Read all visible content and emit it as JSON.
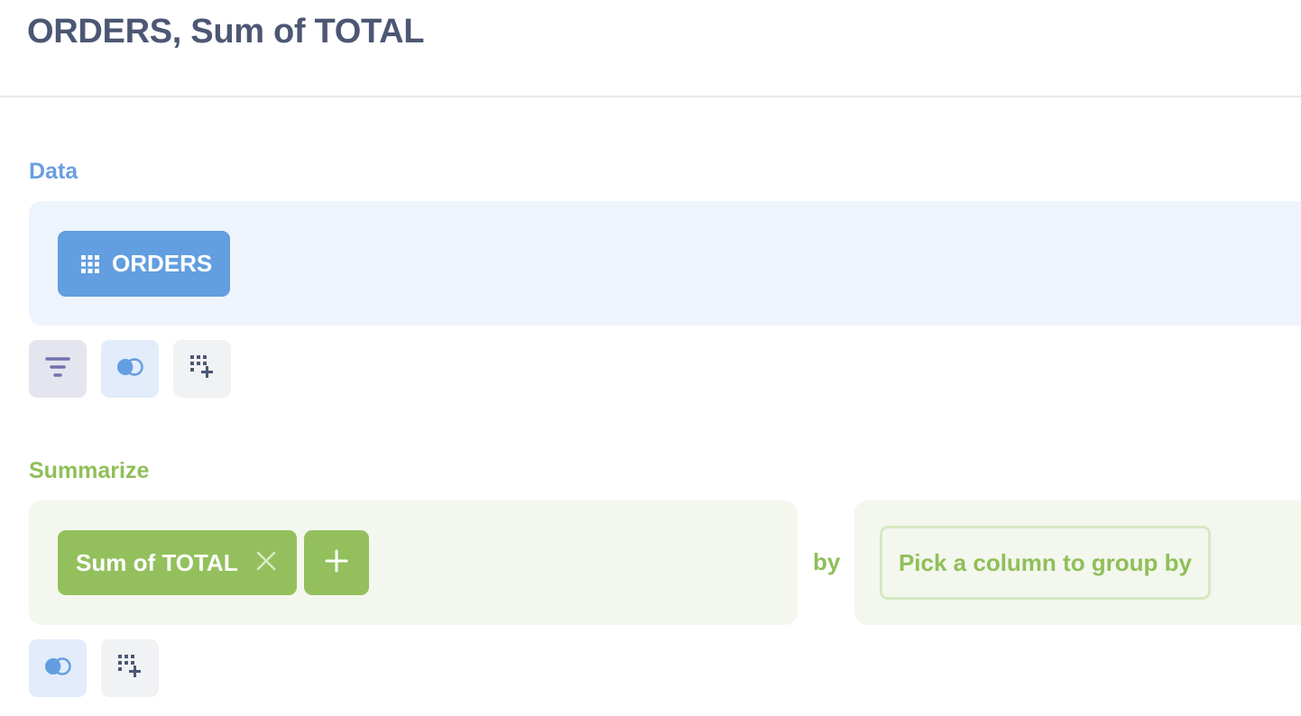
{
  "header": {
    "title": "ORDERS, Sum of TOTAL"
  },
  "data_section": {
    "label": "Data",
    "table_name": "ORDERS",
    "table_icon": "table-grid-icon",
    "actions": [
      {
        "name": "filter",
        "icon": "filter-icon"
      },
      {
        "name": "join",
        "icon": "join-icon"
      },
      {
        "name": "custom-column",
        "icon": "add-column-icon"
      }
    ]
  },
  "summarize_section": {
    "label": "Summarize",
    "aggregation": "Sum of TOTAL",
    "by_label": "by",
    "group_by_placeholder": "Pick a column to group by",
    "actions": [
      {
        "name": "join",
        "icon": "join-icon"
      },
      {
        "name": "custom-column",
        "icon": "add-column-icon"
      }
    ]
  },
  "colors": {
    "title": "#4c5773",
    "data_accent": "#629ee0",
    "data_bg": "#eef4fc",
    "summarize_accent": "#93c05d",
    "summarize_bg": "#f3f7ee",
    "filter_bg": "#e5e5f0",
    "filter_icon": "#7172ad"
  }
}
